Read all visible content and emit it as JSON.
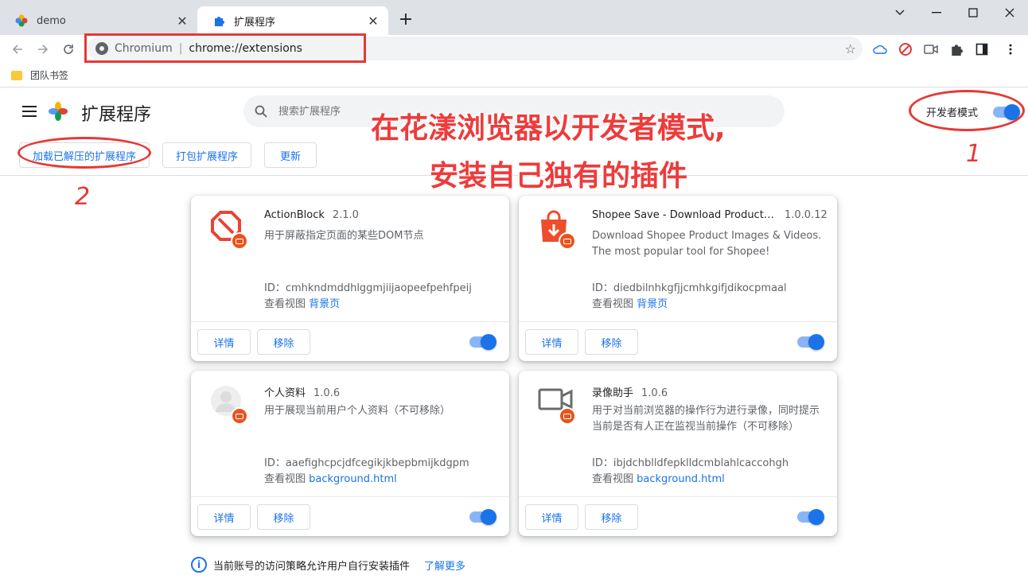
{
  "tabs": [
    {
      "title": "demo",
      "active": false
    },
    {
      "title": "扩展程序",
      "active": true
    }
  ],
  "omnibox": {
    "origin": "Chromium",
    "separator": "|",
    "url": "chrome://extensions"
  },
  "bookmarks": [
    {
      "label": "团队书签",
      "icon": "folder-icon"
    }
  ],
  "header": {
    "title": "扩展程序",
    "search_placeholder": "搜索扩展程序",
    "dev_mode_label": "开发者模式",
    "dev_mode_on": true
  },
  "actions": {
    "load_unpacked": "加载已解压的扩展程序",
    "pack": "打包扩展程序",
    "update": "更新"
  },
  "extensions": [
    {
      "name": "ActionBlock",
      "version": "2.1.0",
      "description": "用于屏蔽指定页面的某些DOM节点",
      "id": "ID：cmhkndmddhlggmjiijaopeefpehfpeij",
      "view_label": "查看视图",
      "view_link": "背景页",
      "details": "详情",
      "remove": "移除",
      "enabled": true
    },
    {
      "name": "Shopee Save - Download Product Imag…",
      "version": "1.0.0.12",
      "description": "Download Shopee Product Images & Videos. The most popular tool for Shopee!",
      "id": "ID：diedbilnhkgfjjcmhkgifjdikocpmaal",
      "view_label": "查看视图",
      "view_link": "背景页",
      "details": "详情",
      "remove": "移除",
      "enabled": true
    },
    {
      "name": "个人资料",
      "version": "1.0.6",
      "description": "用于展现当前用户个人资料（不可移除）",
      "id": "ID：aaefighcpcjdfcegikjkbepbmijkdgpm",
      "view_label": "查看视图",
      "view_link": "background.html",
      "details": "详情",
      "remove": "移除",
      "enabled": true
    },
    {
      "name": "录像助手",
      "version": "1.0.6",
      "description": "用于对当前浏览器的操作行为进行录像，同时提示当前是否有人正在监视当前操作（不可移除）",
      "id": "ID：ibjdchblldfepklldcmblahlcaccohgh",
      "view_label": "查看视图",
      "view_link": "background.html",
      "details": "详情",
      "remove": "移除",
      "enabled": true
    }
  ],
  "footer": {
    "text": "当前账号的访问策略允许用户自行安装插件",
    "link": "了解更多"
  },
  "annotations": {
    "line1": "在花漾浏览器以开发者模式,",
    "line2": "安装自己独有的插件",
    "num1": "1",
    "num2": "2"
  },
  "colors": {
    "accent": "#1a73e8",
    "annotation": "#e53935",
    "badge": "#e8541d"
  }
}
